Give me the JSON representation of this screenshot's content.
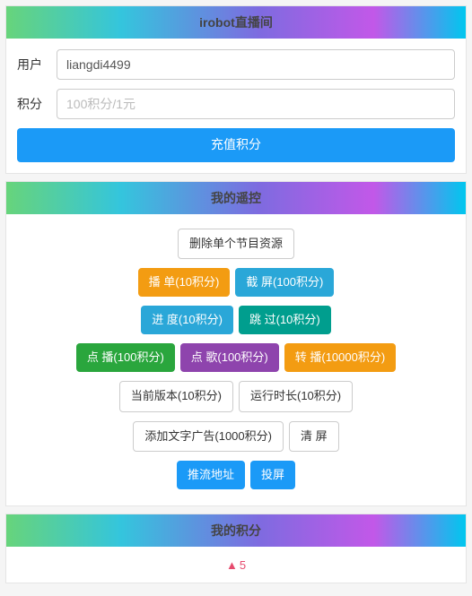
{
  "header": {
    "title": "irobot直播间"
  },
  "user_panel": {
    "user_label": "用户",
    "user_value": "liangdi4499",
    "points_label": "积分",
    "points_placeholder": "100积分/1元",
    "recharge_button": "充值积分"
  },
  "remote": {
    "title": "我的遥控",
    "rows": [
      [
        {
          "label": "删除单个节目资源",
          "style": "default"
        }
      ],
      [
        {
          "label": "播 单(10积分)",
          "style": "orange"
        },
        {
          "label": "截 屏(100积分)",
          "style": "info"
        }
      ],
      [
        {
          "label": "进 度(10积分)",
          "style": "info"
        },
        {
          "label": "跳 过(10积分)",
          "style": "teal"
        }
      ],
      [
        {
          "label": "点 播(100积分)",
          "style": "green"
        },
        {
          "label": "点 歌(100积分)",
          "style": "purple"
        },
        {
          "label": "转 播(10000积分)",
          "style": "orange"
        }
      ],
      [
        {
          "label": "当前版本(10积分)",
          "style": "default"
        },
        {
          "label": "运行时长(10积分)",
          "style": "default"
        }
      ],
      [
        {
          "label": "添加文字广告(1000积分)",
          "style": "default"
        },
        {
          "label": "清  屏",
          "style": "default"
        }
      ],
      [
        {
          "label": "推流地址",
          "style": "primary"
        },
        {
          "label": "投屏",
          "style": "primary"
        }
      ]
    ]
  },
  "points_panel": {
    "title": "我的积分",
    "icon": "▲",
    "icon_name": "points-icon",
    "value": "5"
  },
  "colors": {
    "primary": "#1b9af7",
    "orange": "#f39c12",
    "info": "#2aa7d8",
    "teal": "#009e8e",
    "green": "#2aa63d",
    "purple": "#8e44ad"
  }
}
